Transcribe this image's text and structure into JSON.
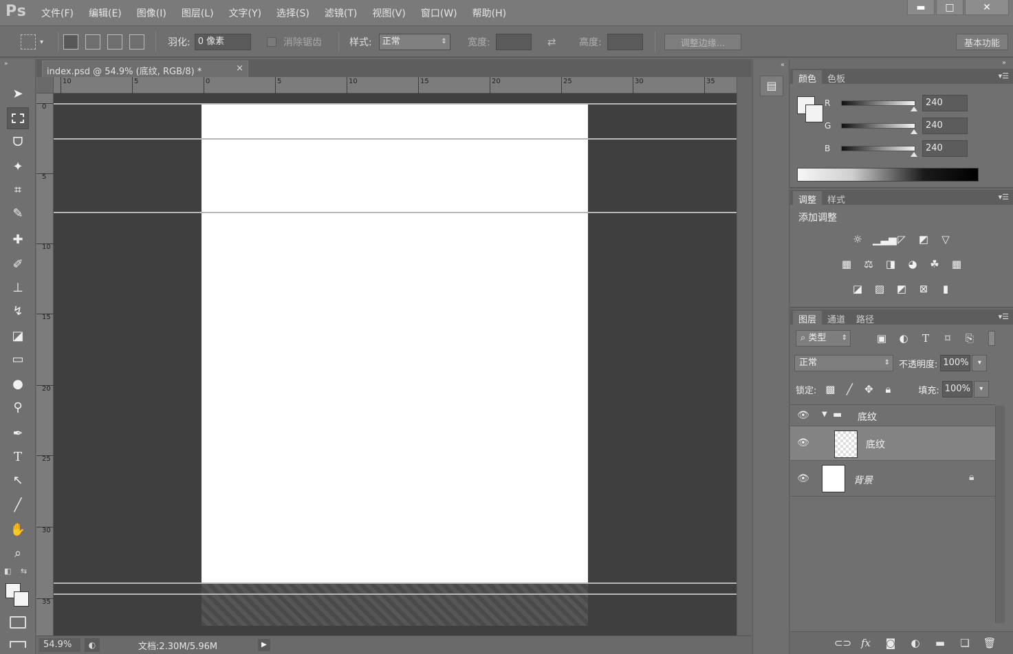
{
  "app": {
    "logo": "Ps"
  },
  "menu": [
    "文件(F)",
    "编辑(E)",
    "图像(I)",
    "图层(L)",
    "文字(Y)",
    "选择(S)",
    "滤镜(T)",
    "视图(V)",
    "窗口(W)",
    "帮助(H)"
  ],
  "window_controls": {
    "minimize": "▬",
    "maximize": "□",
    "close": "✕"
  },
  "options_bar": {
    "feather_label": "羽化:",
    "feather_value": "0 像素",
    "antialias_label": "消除锯齿",
    "style_label": "样式:",
    "style_value": "正常",
    "width_label": "宽度:",
    "height_label": "高度:",
    "refine_edge_label": "调整边缘...",
    "workspace_label": "基本功能"
  },
  "document": {
    "tab_title": "index.psd @ 54.9% (底纹, RGB/8) *",
    "tab_close": "×",
    "ruler_h_labels": [
      "10",
      "5",
      "0",
      "5",
      "10",
      "15",
      "20",
      "25",
      "30",
      "35"
    ],
    "ruler_v_labels": [
      "0",
      "5",
      "10",
      "15",
      "20",
      "25",
      "30",
      "35"
    ]
  },
  "status": {
    "zoom": "54.9%",
    "doc_info": "文档:2.30M/5.96M",
    "arrow": "▶"
  },
  "tools": [
    "move-tool",
    "marquee-tool",
    "lasso-tool",
    "magic-wand-tool",
    "crop-tool",
    "eyedropper-tool",
    "healing-brush-tool",
    "brush-tool",
    "clone-stamp-tool",
    "history-brush-tool",
    "eraser-tool",
    "gradient-tool",
    "blur-tool",
    "dodge-tool",
    "pen-tool",
    "type-tool",
    "path-selection-tool",
    "line-tool",
    "hand-tool",
    "zoom-tool"
  ],
  "panels": {
    "color": {
      "tabs": [
        "颜色",
        "色板"
      ],
      "r_label": "R",
      "r_value": "240",
      "g_label": "G",
      "g_value": "240",
      "b_label": "B",
      "b_value": "240"
    },
    "adjustments": {
      "tabs": [
        "调整",
        "样式"
      ],
      "title": "添加调整"
    },
    "layers": {
      "tabs": [
        "图层",
        "通道",
        "路径"
      ],
      "filter_kind": "类型",
      "blend_mode": "正常",
      "opacity_label": "不透明度:",
      "opacity_value": "100%",
      "lock_label": "锁定:",
      "fill_label": "填充:",
      "fill_value": "100%",
      "items": [
        {
          "name": "底纹",
          "type": "group"
        },
        {
          "name": "底纹",
          "type": "layer",
          "selected": true
        },
        {
          "name": "背景",
          "type": "background",
          "locked": true
        }
      ]
    }
  },
  "colors": {
    "canvas_bg": "#3f3f3f",
    "panel_bg": "#707070",
    "page": "#ffffff"
  }
}
